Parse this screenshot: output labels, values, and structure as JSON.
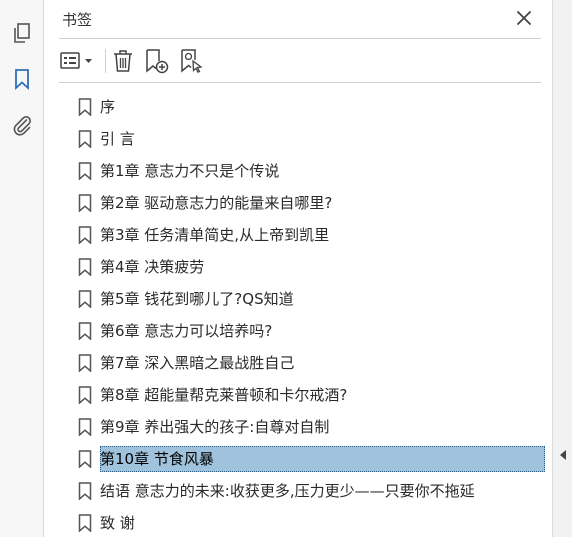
{
  "panel": {
    "title": "书签",
    "close_icon": "close-icon"
  },
  "sidebar": {
    "items": [
      {
        "name": "pages-icon"
      },
      {
        "name": "bookmark-icon",
        "active": true
      },
      {
        "name": "attachment-icon"
      }
    ]
  },
  "toolbar": {
    "items": [
      "options-menu-icon",
      "trash-icon",
      "new-bookmark-icon",
      "bookmark-from-selection-icon"
    ]
  },
  "bookmarks": [
    {
      "label": "序"
    },
    {
      "label": "引 言"
    },
    {
      "label": "第1章 意志力不只是个传说"
    },
    {
      "label": "第2章 驱动意志力的能量来自哪里?"
    },
    {
      "label": "第3章 任务清单简史,从上帝到凯里"
    },
    {
      "label": "第4章 决策疲劳"
    },
    {
      "label": "第5章 钱花到哪儿了?QS知道"
    },
    {
      "label": "第6章 意志力可以培养吗?"
    },
    {
      "label": "第7章 深入黑暗之最战胜自己"
    },
    {
      "label": "第8章 超能量帮克莱普顿和卡尔戒酒?"
    },
    {
      "label": "第9章 养出强大的孩子:自尊对自制"
    },
    {
      "label": "第10章 节食风暴",
      "selected": true
    },
    {
      "label": "结语 意志力的未来:收获更多,压力更少——只要你不拖延"
    },
    {
      "label": "致 谢"
    }
  ],
  "colors": {
    "accent": "#2f6fb3",
    "selection": "#9fc3dc"
  }
}
